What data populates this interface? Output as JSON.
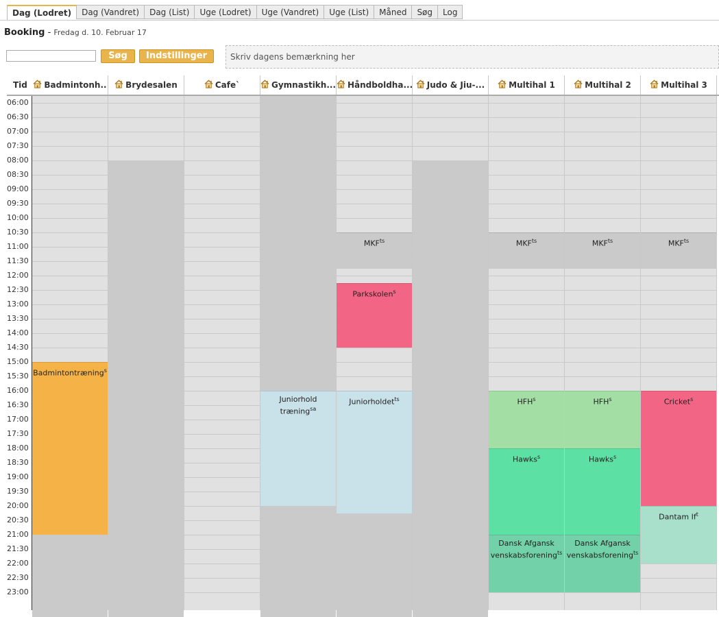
{
  "tabs": [
    "Dag (Lodret)",
    "Dag (Vandret)",
    "Dag (List)",
    "Uge (Lodret)",
    "Uge (Vandret)",
    "Uge (List)",
    "Måned",
    "Søg",
    "Log"
  ],
  "active_tab": 0,
  "header": {
    "title": "Booking",
    "separator": " - ",
    "date": "Fredag d. 10. Februar 17"
  },
  "search": {
    "value": "",
    "button_label": "Søg",
    "settings_label": "Indstillinger"
  },
  "note_placeholder": "Skriv dagens bemærkning her",
  "time_header": "Tid",
  "times": [
    "06:00",
    "06:30",
    "07:00",
    "07:30",
    "08:00",
    "08:30",
    "09:00",
    "09:30",
    "10:00",
    "10:30",
    "11:00",
    "11:30",
    "12:00",
    "12:30",
    "13:00",
    "13:30",
    "14:00",
    "14:30",
    "15:00",
    "15:30",
    "16:00",
    "16:30",
    "17:00",
    "17:30",
    "18:00",
    "18:30",
    "19:00",
    "19:30",
    "20:00",
    "20:30",
    "21:00",
    "21:30",
    "22:00",
    "22:30",
    "23:00"
  ],
  "colors": {
    "accent": "#e9b44c",
    "closed": "#cacaca",
    "open": "#e1e1e1"
  },
  "columns": [
    {
      "name": "Badmintonh..",
      "closed": [
        [
          21.0,
          24.0
        ]
      ]
    },
    {
      "name": "Brydesalen",
      "closed": [
        [
          8.0,
          24.0
        ]
      ]
    },
    {
      "name": "Cafe`",
      "closed": []
    },
    {
      "name": "Gymnastikh...",
      "closed": [
        [
          6.0,
          16.0
        ],
        [
          20.0,
          24.0
        ]
      ]
    },
    {
      "name": "Håndboldha...",
      "closed": [
        [
          10.5,
          11.75
        ],
        [
          20.25,
          24.0
        ]
      ]
    },
    {
      "name": "Judo & Jiu-...",
      "closed": [
        [
          8.0,
          24.0
        ]
      ]
    },
    {
      "name": "Multihal 1",
      "closed": [
        [
          10.5,
          11.75
        ]
      ]
    },
    {
      "name": "Multihal 2",
      "closed": [
        [
          10.5,
          11.75
        ]
      ]
    },
    {
      "name": "Multihal 3",
      "closed": [
        [
          10.5,
          11.75
        ]
      ]
    }
  ],
  "events": [
    {
      "col": 0,
      "start": 15.0,
      "end": 21.0,
      "title": "Badmintontræning",
      "sup": "s",
      "color": "#f5b246"
    },
    {
      "col": 3,
      "start": 16.0,
      "end": 20.0,
      "title": "Juniorhold træning",
      "sup": "sa",
      "color": "#c9e1e8"
    },
    {
      "col": 4,
      "start": 10.5,
      "end": 11.75,
      "title": "MKF",
      "sup": "ts",
      "color": "#cacaca"
    },
    {
      "col": 4,
      "start": 12.25,
      "end": 14.5,
      "title": "Parkskolen",
      "sup": "s",
      "color": "#f36585"
    },
    {
      "col": 4,
      "start": 16.0,
      "end": 20.25,
      "title": "Juniorholdet",
      "sup": "ts",
      "color": "#c9e1e8"
    },
    {
      "col": 6,
      "start": 10.5,
      "end": 11.75,
      "title": "MKF",
      "sup": "ts",
      "color": "#cacaca"
    },
    {
      "col": 6,
      "start": 16.0,
      "end": 18.0,
      "title": "HFH",
      "sup": "s",
      "color": "#a3dfa4"
    },
    {
      "col": 6,
      "start": 18.0,
      "end": 21.0,
      "title": "Hawks",
      "sup": "s",
      "color": "#5de0a4"
    },
    {
      "col": 6,
      "start": 21.0,
      "end": 23.0,
      "title": "Dansk Afgansk venskabsforening",
      "sup": "ts",
      "color": "#72d1a9"
    },
    {
      "col": 7,
      "start": 10.5,
      "end": 11.75,
      "title": "MKF",
      "sup": "ts",
      "color": "#cacaca"
    },
    {
      "col": 7,
      "start": 16.0,
      "end": 18.0,
      "title": "HFH",
      "sup": "s",
      "color": "#a3dfa4"
    },
    {
      "col": 7,
      "start": 18.0,
      "end": 21.0,
      "title": "Hawks",
      "sup": "s",
      "color": "#5de0a4"
    },
    {
      "col": 7,
      "start": 21.0,
      "end": 23.0,
      "title": "Dansk Afgansk venskabsforening",
      "sup": "ts",
      "color": "#72d1a9"
    },
    {
      "col": 8,
      "start": 10.5,
      "end": 11.75,
      "title": "MKF",
      "sup": "ts",
      "color": "#cacaca"
    },
    {
      "col": 8,
      "start": 16.0,
      "end": 20.0,
      "title": "Cricket",
      "sup": "s",
      "color": "#f36585"
    },
    {
      "col": 8,
      "start": 20.0,
      "end": 22.0,
      "title": "Dantam If",
      "sup": "t",
      "color": "#a8e0cc"
    }
  ]
}
